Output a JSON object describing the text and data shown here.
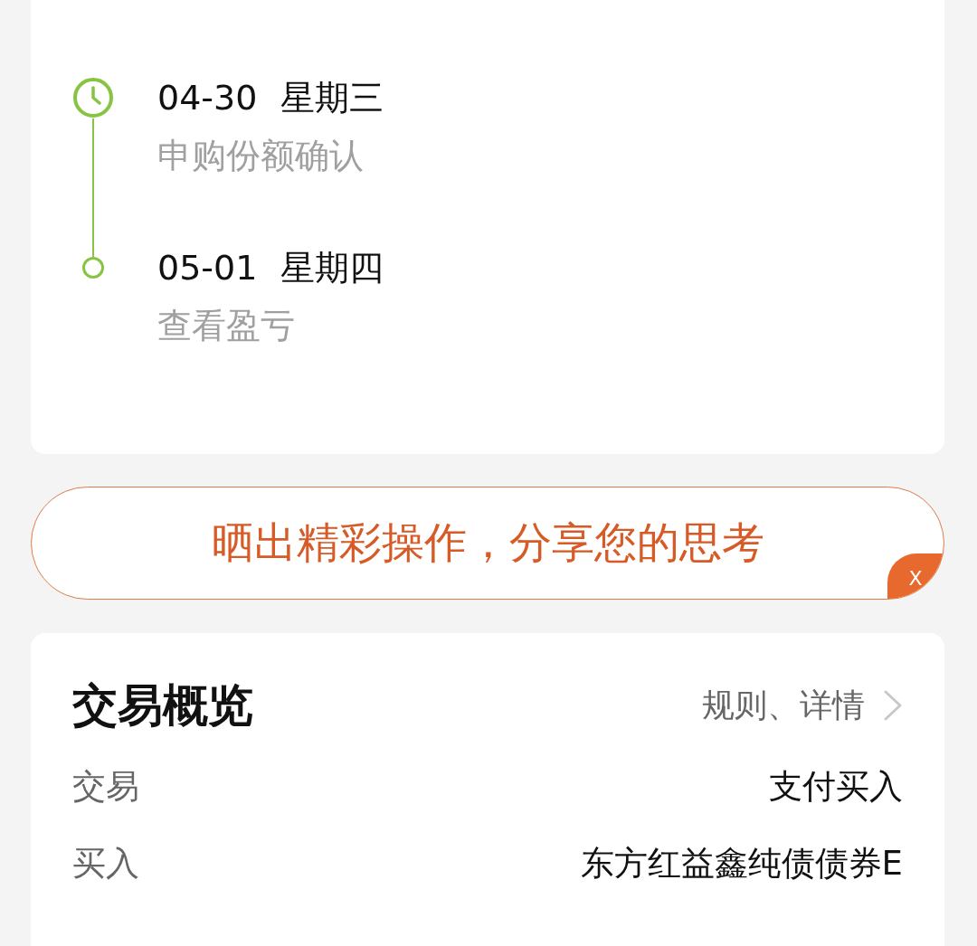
{
  "timeline": [
    {
      "kind": "current",
      "date": "04-30",
      "weekday": "星期三",
      "description": "申购份额确认"
    },
    {
      "kind": "upcoming",
      "date": "05-01",
      "weekday": "星期四",
      "description": "查看盈亏"
    }
  ],
  "share_banner": {
    "text": "晒出精彩操作，分享您的思考",
    "close": "X"
  },
  "trade_overview": {
    "title": "交易概览",
    "link": "规则、详情",
    "rows": [
      {
        "label": "交易",
        "value": "支付买入"
      },
      {
        "label": "买入",
        "value": "东方红益鑫纯债债券E"
      }
    ]
  }
}
